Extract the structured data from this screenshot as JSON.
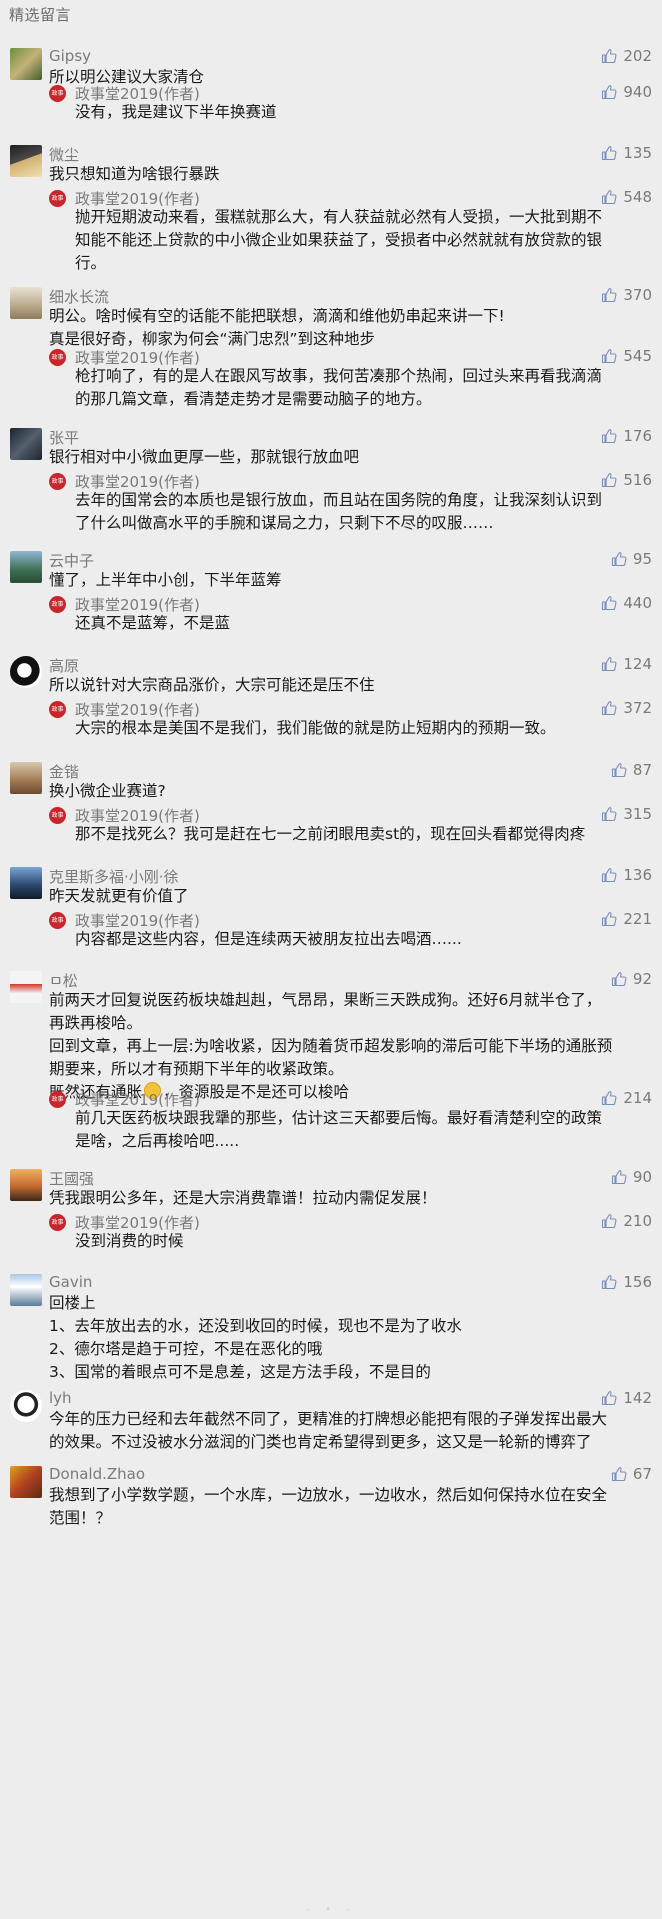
{
  "section_title": "精选留言",
  "author_label": "政事堂2019(作者)",
  "author_logo_text": "政事堂",
  "colors": {
    "background": "#ededed",
    "name_gray": "#7a7a7a",
    "author_logo_red": "#c8262a",
    "text": "#1a1a1a"
  },
  "icons": {
    "like": "thumbs-up-icon",
    "author": "author-logo-icon"
  },
  "comments": [
    {
      "name": "Gipsy",
      "likes": "202",
      "text": [
        "所以明公建议大家清仓"
      ],
      "reply": {
        "likes": "940",
        "text": [
          "没有，我是建议下半年换赛道"
        ]
      }
    },
    {
      "name": "微尘",
      "likes": "135",
      "text": [
        "我只想知道为啥银行暴跌"
      ],
      "reply": {
        "likes": "548",
        "text": [
          "抛开短期波动来看，蛋糕就那么大，有人获益就必然有人受损，一大批到期不",
          "知能不能还上贷款的中小微企业如果获益了，受损者中必然就就有放贷款的银",
          "行。"
        ]
      }
    },
    {
      "name": "细水长流",
      "likes": "370",
      "text": [
        "明公。啥时候有空的话能不能把联想，滴滴和维他奶串起来讲一下!",
        "真是很好奇，柳家为何会“满门忠烈”到这种地步"
      ],
      "reply": {
        "likes": "545",
        "text": [
          "枪打响了，有的是人在跟风写故事，我何苦凑那个热闹，回过头来再看我滴滴",
          "的那几篇文章，看清楚走势才是需要动脑子的地方。"
        ]
      }
    },
    {
      "name": "张平",
      "likes": "176",
      "text": [
        "银行相对中小微血更厚一些，那就银行放血吧"
      ],
      "reply": {
        "likes": "516",
        "text": [
          "去年的国常会的本质也是银行放血，而且站在国务院的角度，让我深刻认识到",
          "了什么叫做高水平的手腕和谋局之力，只剩下不尽的叹服……"
        ]
      }
    },
    {
      "name": "云中子",
      "likes": "95",
      "text": [
        "懂了，上半年中小创，下半年蓝筹"
      ],
      "reply": {
        "likes": "440",
        "text": [
          "还真不是蓝筹，不是蓝"
        ]
      }
    },
    {
      "name": "高原",
      "likes": "124",
      "text": [
        "所以说针对大宗商品涨价，大宗可能还是压不住"
      ],
      "reply": {
        "likes": "372",
        "text": [
          "大宗的根本是美国不是我们，我们能做的就是防止短期内的预期一致。"
        ]
      }
    },
    {
      "name": "金锴",
      "likes": "87",
      "text": [
        "换小微企业赛道?"
      ],
      "reply": {
        "likes": "315",
        "text": [
          "那不是找死么？我可是赶在七一之前闭眼甩卖st的，现在回头看都觉得肉疼"
        ]
      }
    },
    {
      "name": "克里斯多福·小刚·徐",
      "likes": "136",
      "text": [
        "昨天发就更有价值了"
      ],
      "reply": {
        "likes": "221",
        "text": [
          "内容都是这些内容，但是连续两天被朋友拉出去喝酒…..."
        ]
      }
    },
    {
      "name": "ㅁ松",
      "likes": "92",
      "text": [
        "前两天才回复说医药板块雄赳赳，气昂昂，果断三天跌成狗。还好6月就半仓了，",
        "再跌再梭哈。",
        "回到文章，再上一层:为啥收紧，因为随着货币超发影响的滞后可能下半场的通胀预",
        "期要来，所以才有预期下半年的收紧政策。",
        "既然还有通胀[emoji]，资源股是不是还可以梭哈"
      ],
      "reply": {
        "likes": "214",
        "text": [
          "前几天医药板块跟我犟的那些，估计这三天都要后悔。最好看清楚利空的政策",
          "是啥，之后再梭哈吧....."
        ]
      }
    },
    {
      "name": "王國强",
      "likes": "90",
      "text": [
        "凭我跟明公多年，还是大宗消费靠谱！拉动内需促发展！"
      ],
      "reply": {
        "likes": "210",
        "text": [
          "没到消费的时候"
        ]
      }
    },
    {
      "name": "Gavin",
      "likes": "156",
      "text": [
        "回楼上",
        "1、去年放出去的水，还没到收回的时候，现也不是为了收水",
        "2、德尔塔是趋于可控，不是在恶化的哦",
        "3、国常的着眼点可不是息差，这是方法手段，不是目的"
      ]
    },
    {
      "name": "lyh",
      "likes": "142",
      "text": [
        "今年的压力已经和去年截然不同了，更精准的打牌想必能把有限的子弹发挥出最大",
        "的效果。不过没被水分滋润的门类也肯定希望得到更多，这又是一轮新的博弈了"
      ]
    },
    {
      "name": "Donald.Zhao",
      "likes": "67",
      "text": [
        "我想到了小学数学题，一个水库，一边放水，一边收水，然后如何保持水位在安全",
        "范围！？"
      ]
    }
  ]
}
